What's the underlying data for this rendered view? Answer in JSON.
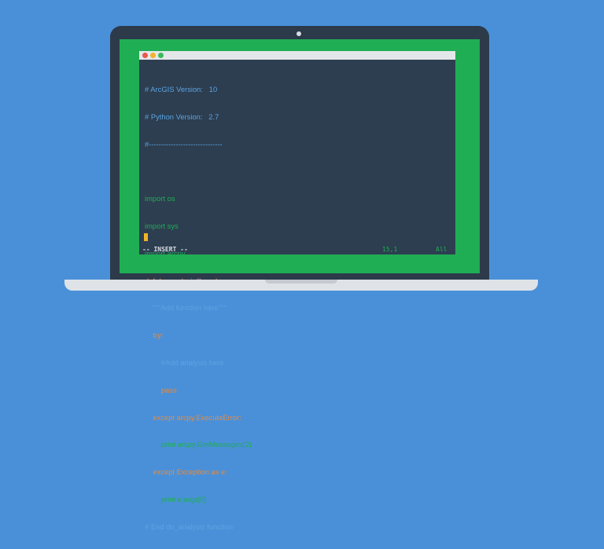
{
  "colors": {
    "background": "#4a90d9",
    "screen_border": "#1fae54",
    "editor_bg": "#2d3e50",
    "comment": "#5ba3e0",
    "keyword_green": "#1fae54",
    "keyword_orange": "#e88a3a",
    "argument_purple": "#c487e0",
    "cursor": "#f0b429"
  },
  "window": {
    "buttons": [
      "close",
      "minimize",
      "maximize"
    ]
  },
  "code": {
    "line1": "# ArcGIS Version:   10",
    "line2": "# Python Version:   2.7",
    "line3": "#------------------------------",
    "line5": "import os",
    "line6": "import sys",
    "line7": "import arcpy",
    "line8_def": "def do_analysis(",
    "line8_args": "*argv",
    "line8_end": "):",
    "line9": "    \"\"\"Add function here\"\"\"",
    "line10": "    try:",
    "line11": "        #Add analysis here",
    "line12": "        pass",
    "line13": "    except arcpy.ExecuteError:",
    "line14": "        print arcpy.GetMessages(2)",
    "line15": "    except Exception as e:",
    "line16": "        print e.args[0]",
    "line17": "# End do_analysis function"
  },
  "status": {
    "mode": "-- INSERT --",
    "position": "15,1",
    "scroll": "All"
  }
}
